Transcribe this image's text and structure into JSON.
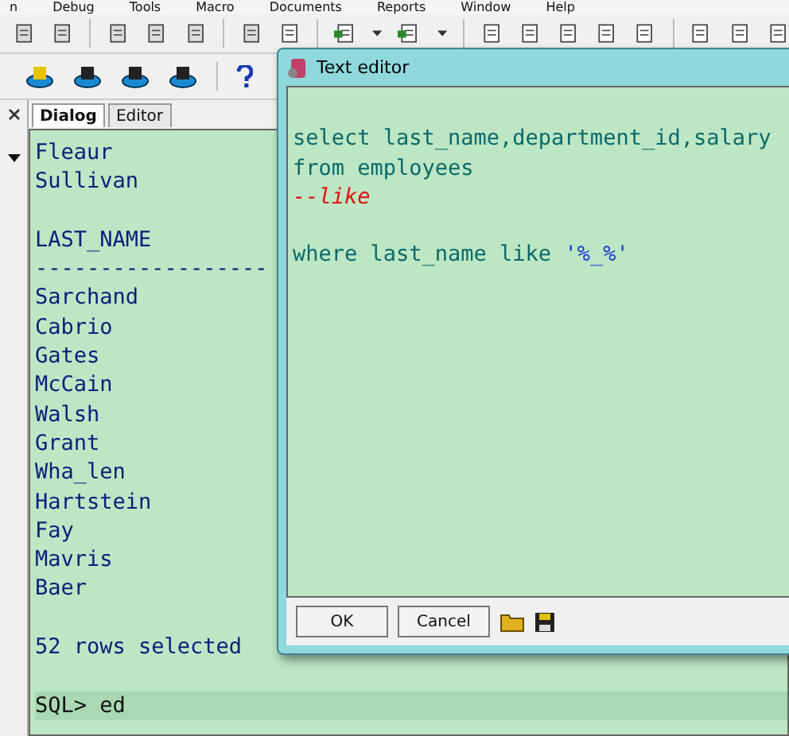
{
  "menu_bar": {
    "items": [
      "n",
      "Debug",
      "Tools",
      "Macro",
      "Documents",
      "Reports",
      "Window",
      "Help"
    ]
  },
  "output_tabs": [
    {
      "label": "Dialog",
      "selected": true
    },
    {
      "label": "Editor",
      "selected": false
    }
  ],
  "output": {
    "lines": [
      {
        "kind": "text",
        "text": "Fleaur"
      },
      {
        "kind": "text",
        "text": "Sullivan"
      },
      {
        "kind": "blank"
      },
      {
        "kind": "text",
        "text": "LAST_NAME"
      },
      {
        "kind": "text",
        "text": "------------------"
      },
      {
        "kind": "text",
        "text": "Sarchand"
      },
      {
        "kind": "text",
        "text": "Cabrio"
      },
      {
        "kind": "text",
        "text": "Gates"
      },
      {
        "kind": "text",
        "text": "McCain"
      },
      {
        "kind": "text",
        "text": "Walsh"
      },
      {
        "kind": "text",
        "text": "Grant"
      },
      {
        "kind": "text",
        "text": "Wha_len"
      },
      {
        "kind": "text",
        "text": "Hartstein"
      },
      {
        "kind": "text",
        "text": "Fay"
      },
      {
        "kind": "text",
        "text": "Mavris"
      },
      {
        "kind": "text",
        "text": "Baer"
      },
      {
        "kind": "blank"
      },
      {
        "kind": "text",
        "text": "52 rows selected"
      },
      {
        "kind": "blank"
      },
      {
        "kind": "prompt",
        "text": "SQL> ed"
      }
    ]
  },
  "text_editor": {
    "title": "Text editor",
    "lines": [
      {
        "kind": "blank"
      },
      {
        "kind": "code",
        "segments": [
          {
            "kind": "code",
            "text": "select last_name,department_id,salary"
          }
        ]
      },
      {
        "kind": "code",
        "segments": [
          {
            "kind": "code",
            "text": "from employees"
          }
        ]
      },
      {
        "kind": "code",
        "segments": [
          {
            "kind": "comment",
            "text": "--like"
          }
        ]
      },
      {
        "kind": "blank"
      },
      {
        "kind": "code",
        "segments": [
          {
            "kind": "code",
            "text": "where last_name like "
          },
          {
            "kind": "string",
            "text": "'%_%'"
          }
        ]
      }
    ],
    "buttons": [
      {
        "label": "OK"
      },
      {
        "label": "Cancel"
      }
    ]
  }
}
